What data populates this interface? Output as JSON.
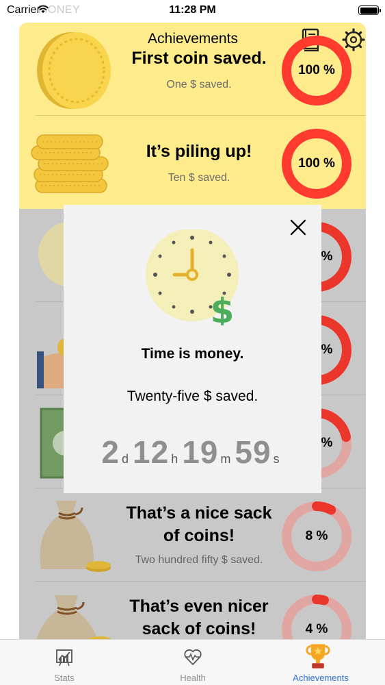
{
  "status_bar": {
    "carrier": "Carrier",
    "app_name_ghost": "MONEY",
    "time": "11:28 PM"
  },
  "header": {
    "title": "Achievements",
    "book_icon": "book-icon",
    "settings_icon": "gear-icon"
  },
  "achievements": [
    {
      "title_lines": [
        "First coin saved."
      ],
      "subtitle": "One $ saved.",
      "percent": 100,
      "percent_label": "100 %",
      "state": "unlocked",
      "icon": "single-coin-icon"
    },
    {
      "title_lines": [
        "It’s piling up!"
      ],
      "subtitle": "Ten $ saved.",
      "percent": 100,
      "percent_label": "100 %",
      "state": "unlocked",
      "icon": "coin-stack-icon"
    },
    {
      "percent_label": "%",
      "state": "locked",
      "icon": "clock-icon"
    },
    {
      "percent_label": "%",
      "state": "locked",
      "icon": "hand-money-icon"
    },
    {
      "percent_label": "%",
      "state": "locked",
      "icon": "banknote-icon"
    },
    {
      "title_lines": [
        "That’s a nice sack",
        "of coins!"
      ],
      "subtitle": "Two hundred fifty $ saved.",
      "percent": 8,
      "percent_label": "8 %",
      "state": "locked",
      "icon": "money-sack-icon"
    },
    {
      "title_lines": [
        "That’s even nicer",
        "sack of coins!"
      ],
      "percent": 4,
      "percent_label": "4 %",
      "state": "locked",
      "icon": "big-money-sack-icon"
    }
  ],
  "modal": {
    "icon": "clock-dollar-icon",
    "title": "Time is money.",
    "subtitle": "Twenty-five $ saved.",
    "countdown": [
      {
        "value": "2",
        "unit": "d"
      },
      {
        "value": "12",
        "unit": "h"
      },
      {
        "value": "19",
        "unit": "m"
      },
      {
        "value": "59",
        "unit": "s"
      }
    ]
  },
  "tabs": [
    {
      "label": "Stats",
      "icon": "stats-icon",
      "active": false
    },
    {
      "label": "Health",
      "icon": "heart-pulse-icon",
      "active": false
    },
    {
      "label": "Achievements",
      "icon": "trophy-icon",
      "active": true
    }
  ],
  "colors": {
    "unlocked_bg": "#fdeb8c",
    "locked_bg": "#d9d9d9",
    "ring_full": "#ff3b30",
    "ring_track": "#f5b5b0",
    "modal_bg": "#f2f2f2",
    "active_tab": "#2e6fd6"
  }
}
